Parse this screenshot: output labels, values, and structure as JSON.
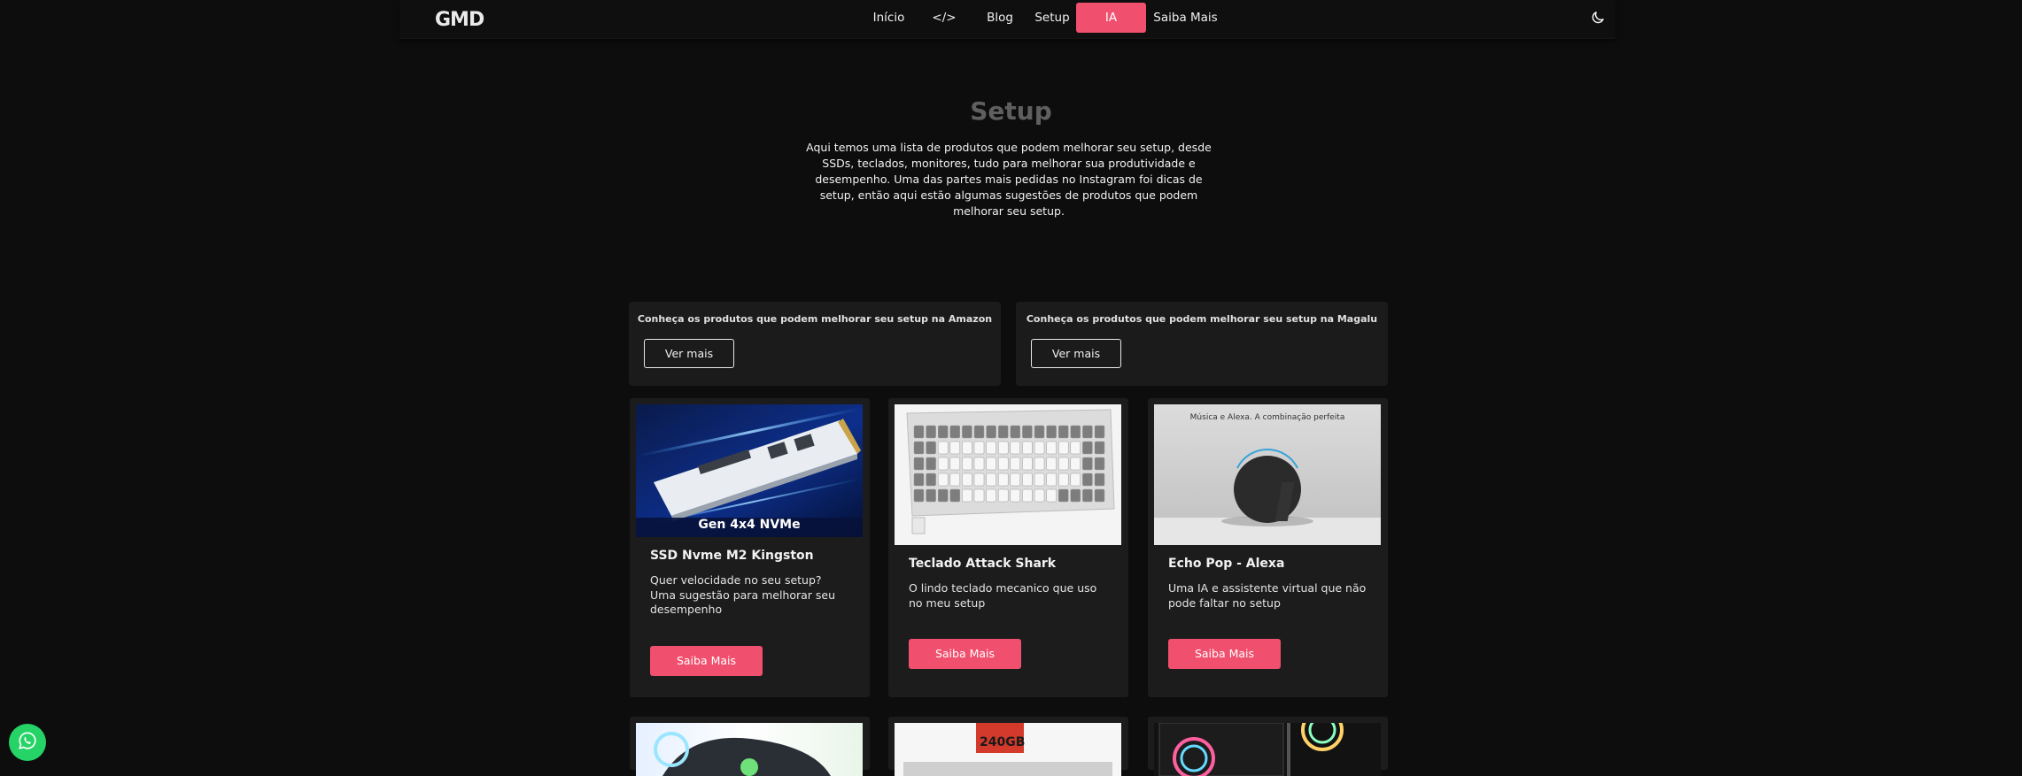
{
  "nav": {
    "logo_text": "GMD",
    "links": [
      {
        "label": "Início",
        "active": false
      },
      {
        "label": "</>",
        "active": false
      },
      {
        "label": "Blog",
        "active": false
      },
      {
        "label": "Setup",
        "active": false
      },
      {
        "label": "IA",
        "active": true
      },
      {
        "label": "Saiba Mais",
        "active": false
      }
    ],
    "theme_icon": "moon-icon"
  },
  "hero": {
    "title": "Setup",
    "description": "Aqui temos uma lista de produtos que podem melhorar seu setup, desde SSDs, teclados, monitores, tudo para melhorar sua produtividade e desempenho. Uma das partes mais pedidas no Instagram foi dicas de setup, então aqui estão algumas sugestões de produtos que podem melhorar seu setup."
  },
  "stores": [
    {
      "text": "Conheça os produtos que podem melhorar seu setup na Amazon",
      "button": "Ver mais"
    },
    {
      "text": "Conheça os produtos que podem melhorar seu setup na Magalu",
      "button": "Ver mais"
    }
  ],
  "products": [
    {
      "title": "SSD Nvme M2 Kingston",
      "description": "Quer velocidade no seu setup? Uma sugestão para melhorar seu desempenho",
      "button": "Saiba Mais",
      "image_caption": "Gen 4x4 NVMe"
    },
    {
      "title": "Teclado Attack Shark",
      "description": "O lindo teclado mecanico que uso no meu setup",
      "button": "Saiba Mais"
    },
    {
      "title": "Echo Pop - Alexa",
      "description": "Uma IA e assistente virtual que não pode faltar no setup",
      "button": "Saiba Mais",
      "image_caption": "Música e Alexa. A combinação perfeita"
    }
  ],
  "partial_products": [
    {
      "image": "wireless-charger"
    },
    {
      "image": "ssd-240gb",
      "image_caption": "240GB"
    },
    {
      "image": "pc-case-rgb"
    }
  ],
  "colors": {
    "accent": "#f0506e",
    "background": "#0d0d0d",
    "card": "#1c1c1c",
    "whatsapp": "#25d366"
  },
  "floating": {
    "icon": "whatsapp-icon"
  }
}
